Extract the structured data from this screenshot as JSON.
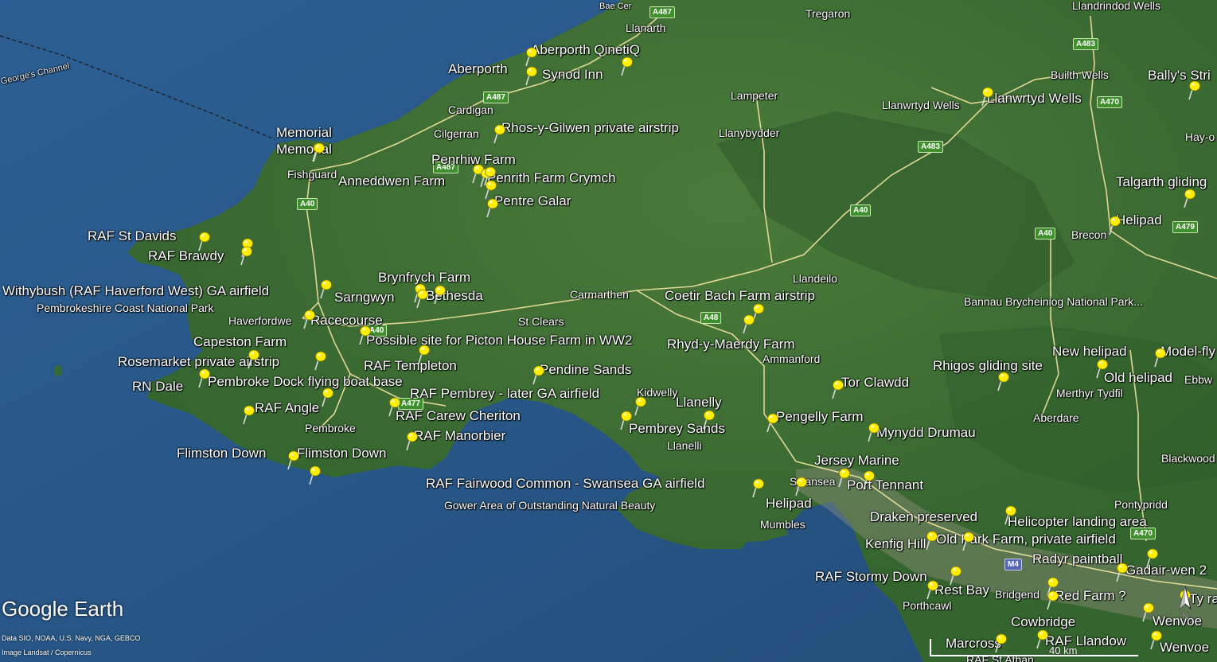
{
  "colors": {
    "sea": "#2a5d8f",
    "land": "#3d6b33",
    "road": "#f2e3a0",
    "pin": "#ffee00"
  },
  "branding": {
    "logo": "Google Earth",
    "credit_data": "Data SIO, NOAA, U.S. Navy, NGA, GEBCO",
    "credit_image": "Image Landsat / Copernicus",
    "scale": "40 km"
  },
  "sea_labels": [
    "George's Channel"
  ],
  "areas": {
    "pembrokeshire": "Pembrokeshire Coast National Park",
    "gower": "Gower Area of Outstanding Natural Beauty",
    "bannau": "Bannau Brycheiniog National Park..."
  },
  "places": {
    "tregaron": "Tregaron",
    "llandrindod": "Llandrindod Wells",
    "llanarth": "Llanarth",
    "baecer": "Bae Cer",
    "builth": "Builth Wells",
    "llanwrtyd": "Llanwrtyd Wells",
    "lampeter": "Lampeter",
    "cardigan": "Cardigan",
    "cilgerran": "Cilgerran",
    "llanybydder": "Llanybydder",
    "hayon": "Hay-o",
    "fishguard": "Fishguard",
    "brecon": "Brecon",
    "llandeilo": "Llandeilo",
    "carmarthen": "Carmarthen",
    "stclears": "St Clears",
    "haverfordwest": "Haverfordwe",
    "ammanford": "Ammanford",
    "ebbw": "Ebbw",
    "merthyr": "Merthyr Tydfil",
    "kidwelly": "Kidwelly",
    "aberdare": "Aberdare",
    "pembroke": "Pembroke",
    "llanelli": "Llanelli",
    "blackwood": "Blackwood",
    "swansea": "Swansea",
    "pontypridd": "Pontypridd",
    "mumbles": "Mumbles",
    "bridgend": "Bridgend",
    "porthcawl": "Porthcawl",
    "rafstathan": "RAF St Athan"
  },
  "roads": [
    "A487",
    "A487",
    "A487",
    "A483",
    "A470",
    "A483",
    "A40",
    "A40",
    "A40",
    "A479",
    "A40",
    "A48",
    "A477",
    "A470",
    "M4"
  ],
  "pins": [
    "Aberporth QinetiQ",
    "Aberporth",
    "Synod Inn",
    "Rhos-y-Gilwen private airstrip",
    "Llanwrtyd Wells",
    "Bally's Stri",
    "Memorial",
    "Memorial",
    "Penrhiw Farm",
    "Anneddwen Farm",
    "Penrith Farm Crymch",
    "Pentre Galar",
    "Talgarth gliding",
    "Helipad",
    "RAF St Davids",
    "RAF Brawdy",
    "Brynfrych Farm",
    "Withybush (RAF Haverford West) GA airfield",
    "Sarngwyn",
    "Bethesda",
    "Coetir Bach Farm airstrip",
    "Racecourse",
    "Possible site for Picton House Farm in WW2",
    "Rhyd-y-Maerdy Farm",
    "Capeston Farm",
    "Rosemarket private airstrip",
    "New helipad",
    "Model-fly",
    "RAF Templeton",
    "Rhigos gliding site",
    "Old helipad",
    "Pendine Sands",
    "Pembroke Dock flying boat base",
    "RN Dale",
    "Tor Clawdd",
    "RAF Pembrey - later GA airfield",
    "Llanelly",
    "RAF Angle",
    "RAF Carew Cheriton",
    "Pengelly Farm",
    "Pembrey Sands",
    "Mynydd Drumau",
    "RAF Manorbier",
    "Flimston Down",
    "Flimston Down",
    "Jersey Marine",
    "RAF Fairwood Common - Swansea GA airfield",
    "Port Tennant",
    "Helipad",
    "Draken preserved",
    "Helicopter landing area",
    "Kenfig Hill",
    "Old Park Farm, private airfield",
    "Radyr paintball",
    "RAF Stormy Down",
    "Gadair-wen 2",
    "Rest Bay",
    "Red Farm ?",
    "Ty ra",
    "Wenvoe",
    "Cowbridge",
    "Marcross",
    "RAF Llandow",
    "Wenvoe"
  ]
}
